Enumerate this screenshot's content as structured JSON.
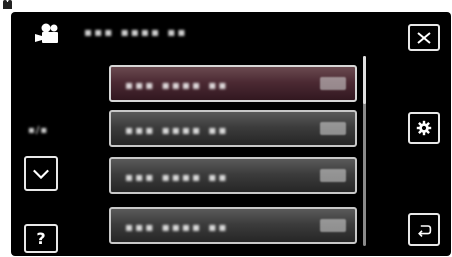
{
  "window": {
    "title_text": "▪▪▪ ▪▪▪▪ ▪▪",
    "mode_icon": "video-camera-icon"
  },
  "sidebar": {
    "page_indicator": "▪/▪",
    "down_button_icon": "chevron-down-icon",
    "help_button_label": "?"
  },
  "menu": {
    "items": [
      {
        "label": "▪▪▪ ▪▪▪▪ ▪▪",
        "selected": true
      },
      {
        "label": "▪▪▪ ▪▪▪▪ ▪▪",
        "selected": false
      },
      {
        "label": "▪▪▪ ▪▪▪▪ ▪▪",
        "selected": false
      },
      {
        "label": "▪▪▪ ▪▪▪▪ ▪▪",
        "selected": false
      }
    ],
    "scroll_position_fraction": 0.0,
    "scroll_visible_fraction": 0.25
  },
  "right_panel": {
    "close_icon": "close-icon",
    "settings_icon": "gear-icon",
    "return_icon": "return-arrow-icon"
  },
  "colors": {
    "background": "#000000",
    "button_border": "#e8e8e8",
    "item_normal": "#3c3c3c",
    "item_selected": "#4c2a33"
  }
}
